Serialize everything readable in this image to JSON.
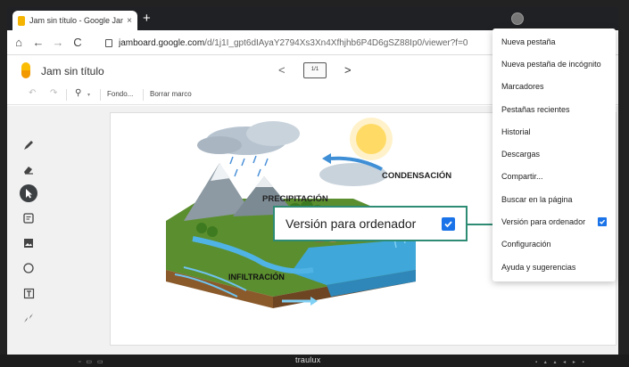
{
  "browser": {
    "tab_title": "Jam sin título - Google Jamb",
    "tab_close": "×",
    "new_tab": "+",
    "nav": {
      "home": "⌂",
      "back": "←",
      "forward": "→",
      "reload": "C"
    },
    "url_host": "jamboard.google.com",
    "url_path": "/d/1j1I_gpt6dIAyaY2794Xs3Xn4Xfhjhb6P4D6gSZ88Ip0/viewer?f=0"
  },
  "jamboard": {
    "title": "Jam sin título",
    "frame_indicator": "1/1",
    "prev": "<",
    "next": ">",
    "toolbar": {
      "undo": "↶",
      "redo": "↷",
      "zoom": "⚲",
      "zoom_caret": "▾",
      "background": "Fondo...",
      "clear_frame": "Borrar marco"
    },
    "tools": [
      {
        "icon": "pen-icon"
      },
      {
        "icon": "eraser-icon"
      },
      {
        "icon": "select-icon",
        "selected": true
      },
      {
        "icon": "sticky-note-icon"
      },
      {
        "icon": "image-icon"
      },
      {
        "icon": "shape-icon"
      },
      {
        "icon": "text-box-icon"
      },
      {
        "icon": "laser-icon"
      }
    ]
  },
  "illustration": {
    "labels": {
      "condensation": "CONDENSACIÓN",
      "precipitation": "PRECIPITACIÓN",
      "infiltration": "INFILTRACIÓN"
    }
  },
  "popup": {
    "label": "Versión para ordenador",
    "checked": true
  },
  "menu": {
    "items": [
      {
        "label": "Nueva pestaña"
      },
      {
        "label": "Nueva pestaña de incógnito"
      },
      {
        "label": "Marcadores"
      },
      {
        "label": "Pestañas recientes"
      },
      {
        "label": "Historial"
      },
      {
        "label": "Descargas"
      },
      {
        "label": "Compartir..."
      },
      {
        "label": "Buscar en la página"
      },
      {
        "label": "Versión para ordenador",
        "checked": true
      },
      {
        "label": "Configuración"
      },
      {
        "label": "Ayuda y sugerencias"
      }
    ]
  },
  "device": {
    "brand": "traulux",
    "left_controls": "▫ ▭ ▭",
    "right_controls": "▪ ▴ ▴ ◂ ▸ ▪"
  },
  "colors": {
    "accent": "#1a73e8",
    "popup_border": "#2e8b74",
    "jam_yellow": "#fbbc04"
  }
}
